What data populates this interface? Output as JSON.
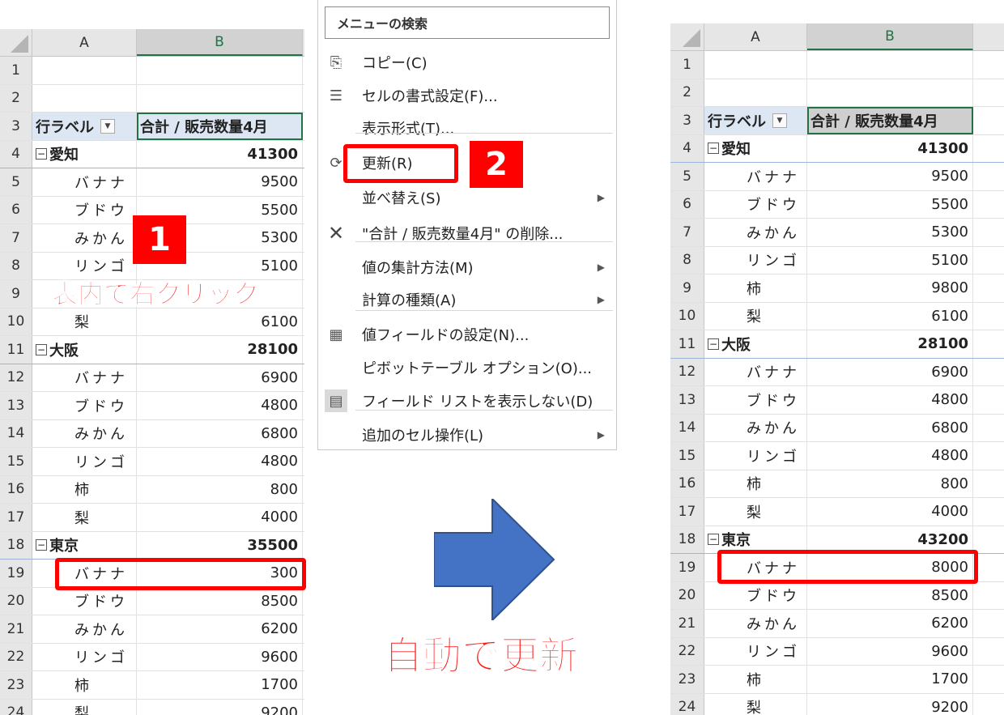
{
  "left_sheet": {
    "col_a": "A",
    "col_b": "B",
    "rows": [
      {
        "n": "1",
        "a": "",
        "b": ""
      },
      {
        "n": "2",
        "a": "",
        "b": ""
      },
      {
        "n": "3",
        "a": "行ラベル",
        "b": "合計 / 販売数量4月"
      },
      {
        "n": "4",
        "a": "愛知",
        "b": "41300"
      },
      {
        "n": "5",
        "a": "バナナ",
        "b": "9500"
      },
      {
        "n": "6",
        "a": "ブドウ",
        "b": "5500"
      },
      {
        "n": "7",
        "a": "みかん",
        "b": "5300"
      },
      {
        "n": "8",
        "a": "リンゴ",
        "b": "5100"
      },
      {
        "n": "9",
        "a": "",
        "b": ""
      },
      {
        "n": "10",
        "a": "梨",
        "b": "6100"
      },
      {
        "n": "11",
        "a": "大阪",
        "b": "28100"
      },
      {
        "n": "12",
        "a": "バナナ",
        "b": "6900"
      },
      {
        "n": "13",
        "a": "ブドウ",
        "b": "4800"
      },
      {
        "n": "14",
        "a": "みかん",
        "b": "6800"
      },
      {
        "n": "15",
        "a": "リンゴ",
        "b": "4800"
      },
      {
        "n": "16",
        "a": "柿",
        "b": "800"
      },
      {
        "n": "17",
        "a": "梨",
        "b": "4000"
      },
      {
        "n": "18",
        "a": "東京",
        "b": "35500"
      },
      {
        "n": "19",
        "a": "バナナ",
        "b": "300"
      },
      {
        "n": "20",
        "a": "ブドウ",
        "b": "8500"
      },
      {
        "n": "21",
        "a": "みかん",
        "b": "6200"
      },
      {
        "n": "22",
        "a": "リンゴ",
        "b": "9600"
      },
      {
        "n": "23",
        "a": "柿",
        "b": "1700"
      },
      {
        "n": "24",
        "a": "梨",
        "b": "9200"
      }
    ]
  },
  "right_sheet": {
    "col_a": "A",
    "col_b": "B",
    "rows": [
      {
        "n": "1",
        "a": "",
        "b": ""
      },
      {
        "n": "2",
        "a": "",
        "b": ""
      },
      {
        "n": "3",
        "a": "行ラベル",
        "b": "合計 / 販売数量4月"
      },
      {
        "n": "4",
        "a": "愛知",
        "b": "41300"
      },
      {
        "n": "5",
        "a": "バナナ",
        "b": "9500"
      },
      {
        "n": "6",
        "a": "ブドウ",
        "b": "5500"
      },
      {
        "n": "7",
        "a": "みかん",
        "b": "5300"
      },
      {
        "n": "8",
        "a": "リンゴ",
        "b": "5100"
      },
      {
        "n": "9",
        "a": "柿",
        "b": "9800"
      },
      {
        "n": "10",
        "a": "梨",
        "b": "6100"
      },
      {
        "n": "11",
        "a": "大阪",
        "b": "28100"
      },
      {
        "n": "12",
        "a": "バナナ",
        "b": "6900"
      },
      {
        "n": "13",
        "a": "ブドウ",
        "b": "4800"
      },
      {
        "n": "14",
        "a": "みかん",
        "b": "6800"
      },
      {
        "n": "15",
        "a": "リンゴ",
        "b": "4800"
      },
      {
        "n": "16",
        "a": "柿",
        "b": "800"
      },
      {
        "n": "17",
        "a": "梨",
        "b": "4000"
      },
      {
        "n": "18",
        "a": "東京",
        "b": "43200"
      },
      {
        "n": "19",
        "a": "バナナ",
        "b": "8000"
      },
      {
        "n": "20",
        "a": "ブドウ",
        "b": "8500"
      },
      {
        "n": "21",
        "a": "みかん",
        "b": "6200"
      },
      {
        "n": "22",
        "a": "リンゴ",
        "b": "9600"
      },
      {
        "n": "23",
        "a": "柿",
        "b": "1700"
      },
      {
        "n": "24",
        "a": "梨",
        "b": "9200"
      }
    ]
  },
  "menu": {
    "search": "メニューの検索",
    "items": [
      {
        "label": "コピー(C)",
        "icon": "copy-icon"
      },
      {
        "label": "セルの書式設定(F)...",
        "icon": "format-cells-icon"
      },
      {
        "label": "表示形式(T)...",
        "icon": ""
      },
      {
        "label": "更新(R)",
        "icon": "refresh-icon"
      },
      {
        "label": "並べ替え(S)",
        "icon": "",
        "submenu": true
      },
      {
        "label": "\"合計 / 販売数量4月\" の削除...",
        "icon": "delete-x-icon"
      },
      {
        "label": "値の集計方法(M)",
        "icon": "",
        "submenu": true
      },
      {
        "label": "計算の種類(A)",
        "icon": "",
        "submenu": true
      },
      {
        "label": "値フィールドの設定(N)...",
        "icon": "field-settings-icon"
      },
      {
        "label": "ピボットテーブル オプション(O)...",
        "icon": ""
      },
      {
        "label": "フィールド リストを表示しない(D)",
        "icon": "field-list-icon"
      },
      {
        "label": "追加のセル操作(L)",
        "icon": "",
        "submenu": true
      }
    ]
  },
  "annotations": {
    "step1": "1",
    "step2": "2",
    "right_click_caption": "表内で右クリック",
    "auto_update_caption": "自動で更新",
    "accent_red": "#ff0000",
    "arrow_blue": "#4472c4"
  }
}
